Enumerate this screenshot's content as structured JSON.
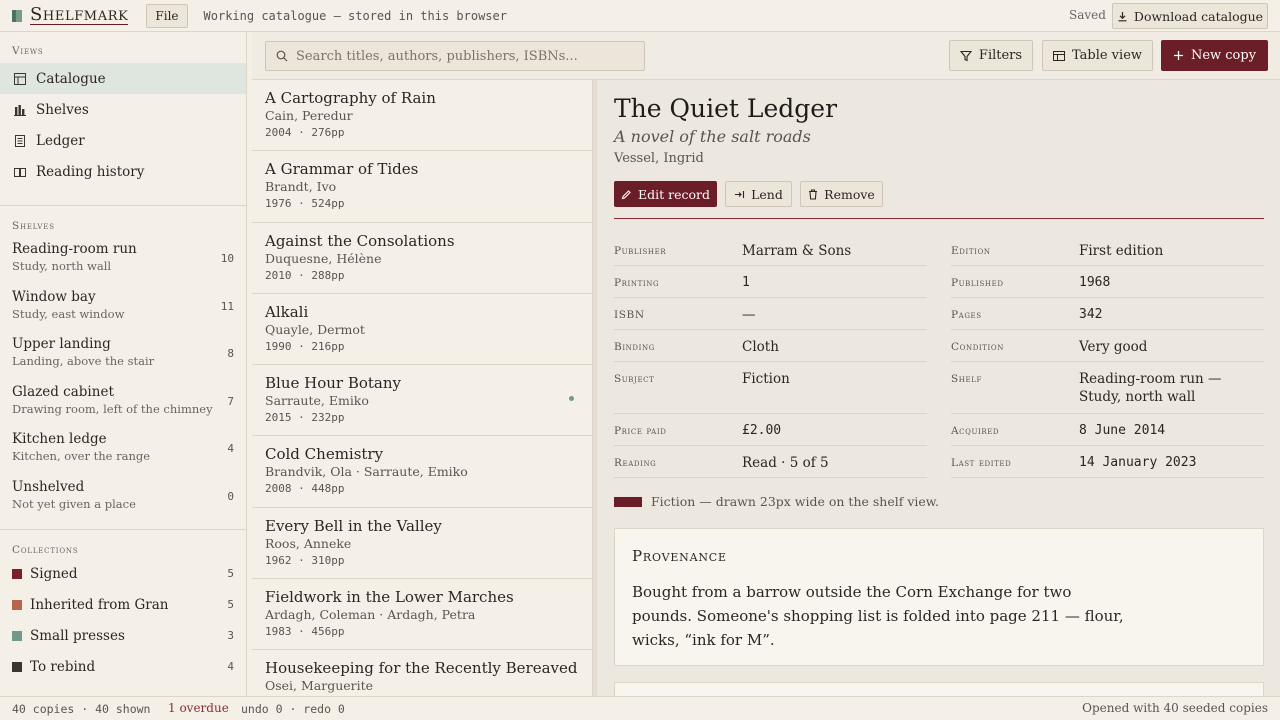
{
  "app": {
    "name": "Shelfmark",
    "file_label": "File",
    "working": "Working catalogue — stored in this browser",
    "saved": "Saved",
    "download_label": "Download catalogue"
  },
  "sidebar": {
    "views_heading": "Views",
    "views": [
      {
        "label": "Catalogue",
        "icon": "table-icon"
      },
      {
        "label": "Shelves",
        "icon": "shelves-icon"
      },
      {
        "label": "Ledger",
        "icon": "ledger-icon"
      },
      {
        "label": "Reading history",
        "icon": "book-open-icon"
      }
    ],
    "shelves_heading": "Shelves",
    "shelves": [
      {
        "name": "Reading-room run",
        "sub": "Study, north wall",
        "count": "10"
      },
      {
        "name": "Window bay",
        "sub": "Study, east window",
        "count": "11"
      },
      {
        "name": "Upper landing",
        "sub": "Landing, above the stair",
        "count": "8"
      },
      {
        "name": "Glazed cabinet",
        "sub": "Drawing room, left of the chimney",
        "count": "7"
      },
      {
        "name": "Kitchen ledge",
        "sub": "Kitchen, over the range",
        "count": "4"
      },
      {
        "name": "Unshelved",
        "sub": "Not yet given a place",
        "count": "0"
      }
    ],
    "collections_heading": "Collections",
    "collections": [
      {
        "name": "Signed",
        "count": "5",
        "color": "#7a1f2b"
      },
      {
        "name": "Inherited from Gran",
        "count": "5",
        "color": "#b8664a"
      },
      {
        "name": "Small presses",
        "count": "3",
        "color": "#6f9a8a"
      },
      {
        "name": "To rebind",
        "count": "4",
        "color": "#3b3531"
      }
    ]
  },
  "toolbar": {
    "search_placeholder": "Search titles, authors, publishers, ISBNs...",
    "filters_label": "Filters",
    "table_label": "Table view",
    "new_label": "New copy"
  },
  "books": [
    {
      "title": "A Cartography of Rain",
      "author": "Cain, Peredur",
      "meta": "2004 · 276pp"
    },
    {
      "title": "A Grammar of Tides",
      "author": "Brandt, Ivo",
      "meta": "1976 · 524pp"
    },
    {
      "title": "Against the Consolations",
      "author": "Duquesne, Hélène",
      "meta": "2010 · 288pp"
    },
    {
      "title": "Alkali",
      "author": "Quayle, Dermot",
      "meta": "1990 · 216pp"
    },
    {
      "title": "Blue Hour Botany",
      "author": "Sarraute, Emiko",
      "meta": "2015 · 232pp",
      "dot": true
    },
    {
      "title": "Cold Chemistry",
      "author": "Brandvik, Ola · Sarraute, Emiko",
      "meta": "2008 · 448pp"
    },
    {
      "title": "Every Bell in the Valley",
      "author": "Roos, Anneke",
      "meta": "1962 · 310pp"
    },
    {
      "title": "Fieldwork in the Lower Marches",
      "author": "Ardagh, Coleman · Ardagh, Petra",
      "meta": "1983 · 456pp"
    },
    {
      "title": "Housekeeping for the Recently Bereaved",
      "author": "Osei, Marguerite",
      "meta": ""
    }
  ],
  "detail": {
    "title": "The Quiet Ledger",
    "subtitle": "A novel of the salt roads",
    "author": "Vessel, Ingrid",
    "edit_label": "Edit record",
    "lend_label": "Lend",
    "remove_label": "Remove",
    "fields_left": [
      {
        "label": "Publisher",
        "value": "Marram & Sons",
        "mono": false
      },
      {
        "label": "Printing",
        "value": "1",
        "mono": true
      },
      {
        "label": "ISBN",
        "value": "—",
        "mono": false
      },
      {
        "label": "Binding",
        "value": "Cloth",
        "mono": false
      },
      {
        "label": "Subject",
        "value": "Fiction",
        "mono": false
      },
      {
        "label": "Price paid",
        "value": "£2.00",
        "mono": true
      },
      {
        "label": "Reading",
        "value": "Read · 5 of 5",
        "mono": false
      }
    ],
    "fields_right": [
      {
        "label": "Edition",
        "value": "First edition",
        "mono": false
      },
      {
        "label": "Published",
        "value": "1968",
        "mono": true
      },
      {
        "label": "Pages",
        "value": "342",
        "mono": true
      },
      {
        "label": "Condition",
        "value": "Very good",
        "mono": false
      },
      {
        "label": "Shelf",
        "value": "Reading-room run — Study, north wall",
        "mono": false
      },
      {
        "label": "Acquired",
        "value": "8 June 2014",
        "mono": true
      },
      {
        "label": "Last edited",
        "value": "14 January 2023",
        "mono": true
      }
    ],
    "spine_note": "Fiction — drawn 23px wide on the shelf view.",
    "spine_color": "#6b1e28",
    "provenance_heading": "Provenance",
    "provenance_text": "Bought from a barrow outside the Corn Exchange for two pounds. Someone's shopping list is folded into page 211 — flour, wicks, “ink for M”."
  },
  "status": {
    "counts": "40 copies · 40 shown",
    "overdue": "1 overdue",
    "undo": "undo 0 · redo 0",
    "opened": "Opened with 40 seeded copies"
  }
}
